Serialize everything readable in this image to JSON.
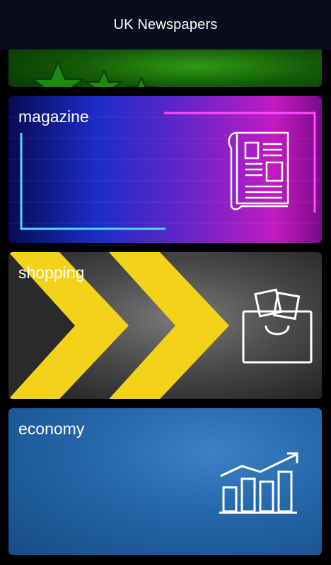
{
  "app": {
    "title": "UK Newspapers"
  },
  "categories": [
    {
      "label": "",
      "icon": "stars-icon"
    },
    {
      "label": "magazine",
      "icon": "newspaper-icon"
    },
    {
      "label": "shopping",
      "icon": "shopping-bag-icon"
    },
    {
      "label": "economy",
      "icon": "bar-chart-growth-icon"
    }
  ],
  "colors": {
    "appbar": "#0b0b1e",
    "magazine_neon_pink": "#ff4dff",
    "magazine_neon_blue": "#4fd7ff",
    "shopping_arrow": "#f3d21a",
    "economy_bg": "#2466a8"
  }
}
